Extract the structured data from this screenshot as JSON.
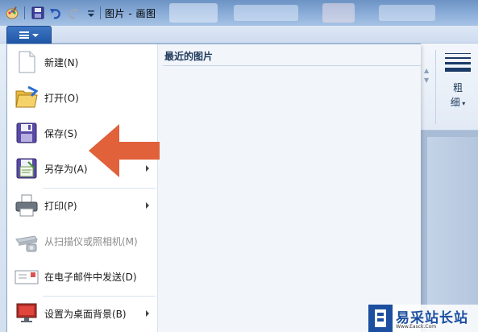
{
  "window": {
    "title": "图片 - 画图"
  },
  "ribbon": {
    "file_menu_button": "app-menu",
    "size_button_label_1": "粗",
    "size_button_label_2": "细"
  },
  "app_menu": {
    "recent_header": "最近的图片",
    "items": [
      {
        "label": "新建(N)",
        "icon": "new-page-icon",
        "enabled": true,
        "submenu": false
      },
      {
        "label": "打开(O)",
        "icon": "open-folder-icon",
        "enabled": true,
        "submenu": false
      },
      {
        "label": "保存(S)",
        "icon": "floppy-save-icon",
        "enabled": true,
        "submenu": false
      },
      {
        "label": "另存为(A)",
        "icon": "save-as-icon",
        "enabled": true,
        "submenu": true
      },
      {
        "label": "打印(P)",
        "icon": "printer-icon",
        "enabled": true,
        "submenu": true
      },
      {
        "label": "从扫描仪或照相机(M)",
        "icon": "scanner-icon",
        "enabled": false,
        "submenu": false
      },
      {
        "label": "在电子邮件中发送(D)",
        "icon": "email-icon",
        "enabled": true,
        "submenu": false
      },
      {
        "label": "设置为桌面背景(B)",
        "icon": "desktop-background-icon",
        "enabled": true,
        "submenu": true
      }
    ]
  },
  "annotation": {
    "arrow_color": "#e0613a"
  },
  "watermark": {
    "text": "易采站长站",
    "subtext": "Www.Easck.Com"
  },
  "colors": {
    "accent": "#1f56a5",
    "ribbon_bg": "#dce7f4",
    "menu_text": "#1a1a1a",
    "disabled_text": "#8a8a8a"
  }
}
